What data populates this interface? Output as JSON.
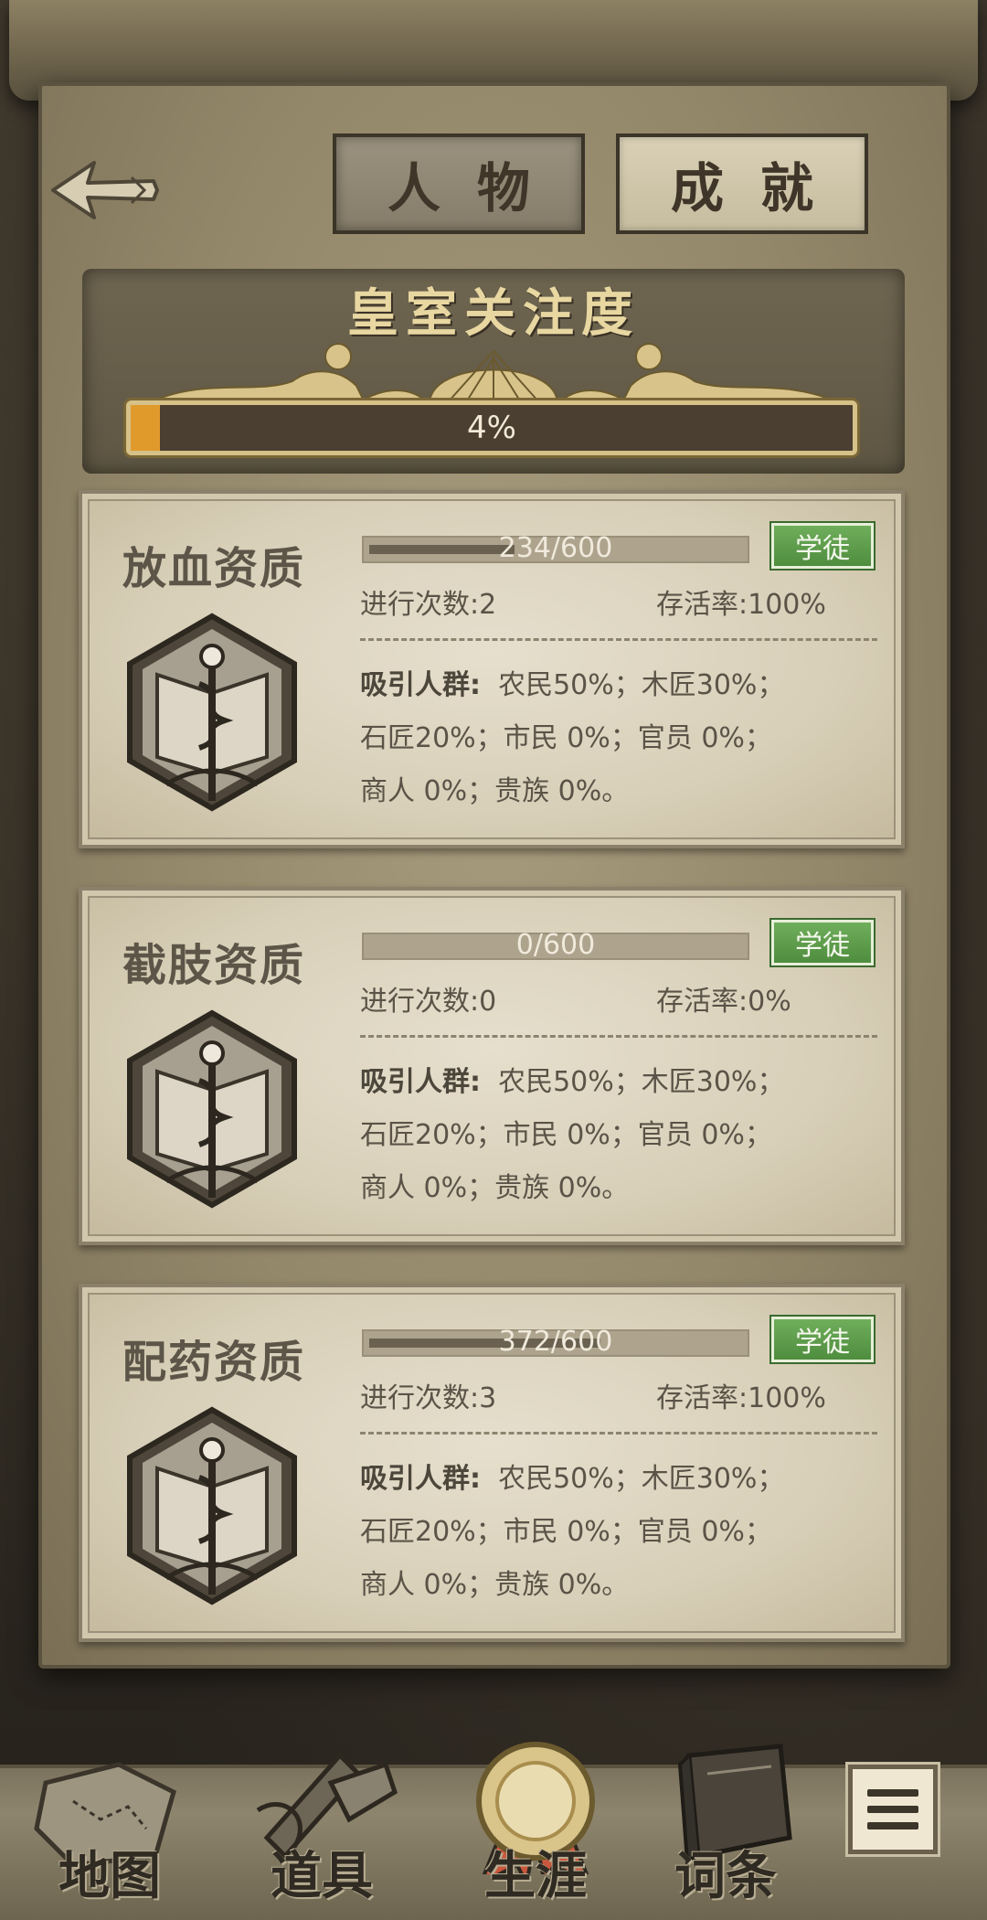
{
  "tabs": {
    "character": "人物",
    "achievement": "成就"
  },
  "royal_attention": {
    "title": "皇室关注度",
    "percent_label": "4%",
    "percent": 4
  },
  "labels": {
    "count_prefix": "进行次数:",
    "survival_prefix": "存活率:",
    "attract_title": "吸引人群:"
  },
  "skills": [
    {
      "name": "放血资质",
      "xp_text": "234/600",
      "xp_fraction": 0.39,
      "level": "学徒",
      "count": "2",
      "survival": "100%",
      "attract1": "农民50%；木匠30%；",
      "attract2": "石匠20%；市民 0%；官员 0%；",
      "attract3": "商人 0%；贵族 0%。"
    },
    {
      "name": "截肢资质",
      "xp_text": "0/600",
      "xp_fraction": 0,
      "level": "学徒",
      "count": "0",
      "survival": "0%",
      "attract1": "农民50%；木匠30%；",
      "attract2": "石匠20%；市民 0%；官员 0%；",
      "attract3": "商人 0%；贵族 0%。"
    },
    {
      "name": "配药资质",
      "xp_text": "372/600",
      "xp_fraction": 0.62,
      "level": "学徒",
      "count": "3",
      "survival": "100%",
      "attract1": "农民50%；木匠30%；",
      "attract2": "石匠20%；市民 0%；官员 0%；",
      "attract3": "商人 0%；贵族 0%。"
    }
  ],
  "nav": {
    "map": "地图",
    "items": "道具",
    "career": "生涯",
    "glossary": "词条"
  }
}
